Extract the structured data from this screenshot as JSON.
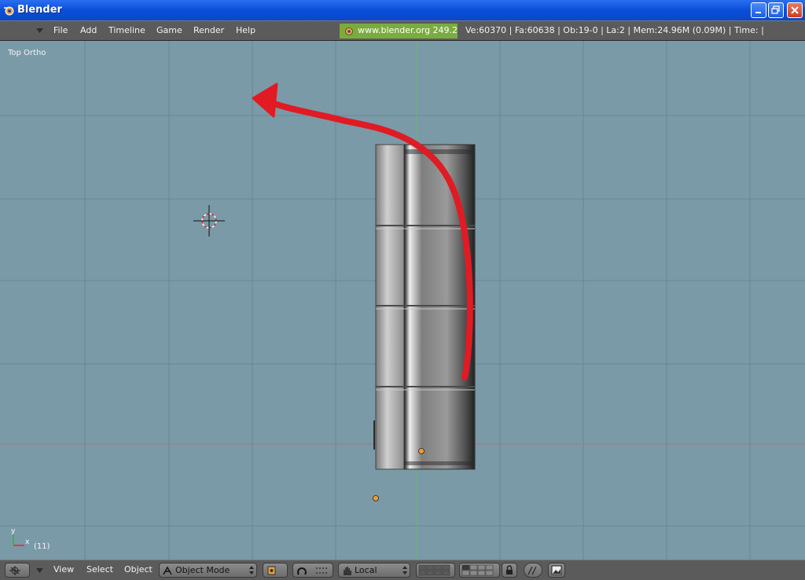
{
  "window": {
    "title": "Blender"
  },
  "menu": {
    "items": [
      "File",
      "Add",
      "Timeline",
      "Game",
      "Render",
      "Help"
    ],
    "url": "www.blender.org 249.2",
    "stats": "Ve:60370 | Fa:60638 | Ob:19-0 | La:2  | Mem:24.96M (0.09M)  | Time: |"
  },
  "viewport": {
    "view_label": "Top Ortho",
    "frame": "(11)",
    "axis_x": "x",
    "axis_y": "y"
  },
  "bottombar": {
    "view": "View",
    "select": "Select",
    "object": "Object",
    "mode": "Object Mode",
    "orientation": "Local"
  },
  "colors": {
    "viewport_bg": "#7a9aa8",
    "grid": "#6a8793",
    "annotation_arrow": "#e01b24",
    "header_bg": "#5b5b5b",
    "url_badge": "#7bab3f",
    "titlebar": "#0a4ed8"
  },
  "icons": [
    "blender-logo-icon",
    "minimize-icon",
    "maximize-icon",
    "close-icon",
    "cursor-3d-icon",
    "view3d-icon",
    "pivot-icon",
    "manipulator-icon",
    "hand-icon",
    "layers-icon",
    "lock-icon",
    "render-icon"
  ]
}
